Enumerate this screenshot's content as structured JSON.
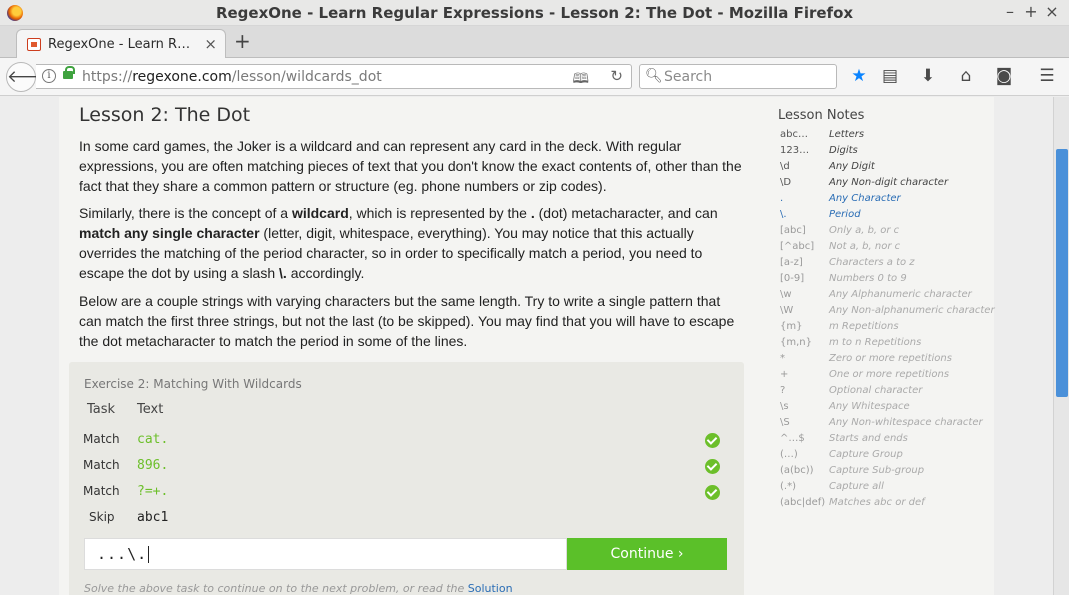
{
  "window": {
    "title": "RegexOne - Learn Regular Expressions - Lesson 2: The Dot - Mozilla Firefox",
    "controls": [
      "–",
      "+",
      "×"
    ]
  },
  "tab": {
    "label": "RegexOne - Learn R…",
    "close": "×",
    "new_tab": "+"
  },
  "navbar": {
    "url_prefix": "https://",
    "url_domain": "regexone.com",
    "url_path": "/lesson/wildcards_dot",
    "search_placeholder": "Search"
  },
  "lesson": {
    "title": "Lesson 2: The Dot",
    "p1": "In some card games, the Joker is a wildcard and can represent any card in the deck. With regular expressions, you are often matching pieces of text that you don't know the exact contents of, other than the fact that they share a common pattern or structure (eg. phone numbers or zip codes).",
    "p2_parts": [
      "Similarly, there is the concept of a ",
      "wildcard",
      ", which is represented by the ",
      ".",
      " (dot) metacharacter, and can ",
      "match any single character",
      " (letter, digit, whitespace, everything). You may notice that this actually overrides the matching of the period character, so in order to specifically match a period, you need to escape the dot by using a slash ",
      "\\.",
      " accordingly."
    ],
    "p3": "Below are a couple strings with varying characters but the same length. Try to write a single pattern that can match the first three strings, but not the last (to be skipped). You may find that you will have to escape the dot metacharacter to match the period in some of the lines."
  },
  "exercise": {
    "title": "Exercise 2: Matching With Wildcards",
    "col_task": "Task",
    "col_text": "Text",
    "rows": [
      {
        "task": "Match",
        "text": "cat.",
        "done": true
      },
      {
        "task": "Match",
        "text": "896.",
        "done": true
      },
      {
        "task": "Match",
        "text": "?=+.",
        "done": true
      },
      {
        "task": "Skip",
        "text": "abc1",
        "done": false
      }
    ],
    "answer": "...\\.",
    "continue_label": "Continue ›",
    "note_text": "Solve the above task to continue on to the next problem, or read the ",
    "note_link": "Solution"
  },
  "notes": {
    "title": "Lesson Notes",
    "items": [
      {
        "k": "abc…",
        "v": "Letters",
        "state": "done"
      },
      {
        "k": "123…",
        "v": "Digits",
        "state": "done"
      },
      {
        "k": "\\d",
        "v": "Any Digit",
        "state": "done"
      },
      {
        "k": "\\D",
        "v": "Any Non-digit character",
        "state": "done"
      },
      {
        "k": ".",
        "v": "Any Character",
        "state": "current"
      },
      {
        "k": "\\.",
        "v": "Period",
        "state": "current"
      },
      {
        "k": "[abc]",
        "v": "Only a, b, or c",
        "state": "todo"
      },
      {
        "k": "[^abc]",
        "v": "Not a, b, nor c",
        "state": "todo"
      },
      {
        "k": "[a-z]",
        "v": "Characters a to z",
        "state": "todo"
      },
      {
        "k": "[0-9]",
        "v": "Numbers 0 to 9",
        "state": "todo"
      },
      {
        "k": "\\w",
        "v": "Any Alphanumeric character",
        "state": "todo"
      },
      {
        "k": "\\W",
        "v": "Any Non-alphanumeric character",
        "state": "todo"
      },
      {
        "k": "{m}",
        "v": "m Repetitions",
        "state": "todo"
      },
      {
        "k": "{m,n}",
        "v": "m to n Repetitions",
        "state": "todo"
      },
      {
        "k": "*",
        "v": "Zero or more repetitions",
        "state": "todo"
      },
      {
        "k": "+",
        "v": "One or more repetitions",
        "state": "todo"
      },
      {
        "k": "?",
        "v": "Optional character",
        "state": "todo"
      },
      {
        "k": "\\s",
        "v": "Any Whitespace",
        "state": "todo"
      },
      {
        "k": "\\S",
        "v": "Any Non-whitespace character",
        "state": "todo"
      },
      {
        "k": "^…$",
        "v": "Starts and ends",
        "state": "todo"
      },
      {
        "k": "(…)",
        "v": "Capture Group",
        "state": "todo"
      },
      {
        "k": "(a(bc))",
        "v": "Capture Sub-group",
        "state": "todo"
      },
      {
        "k": "(.*)",
        "v": "Capture all",
        "state": "todo"
      },
      {
        "k": "(abc|def)",
        "v": "Matches abc or def",
        "state": "todo"
      }
    ]
  },
  "colors": {
    "accent_green": "#5bc029",
    "link_blue": "#2a6db5",
    "scrollbar_blue": "#4a90d9"
  }
}
